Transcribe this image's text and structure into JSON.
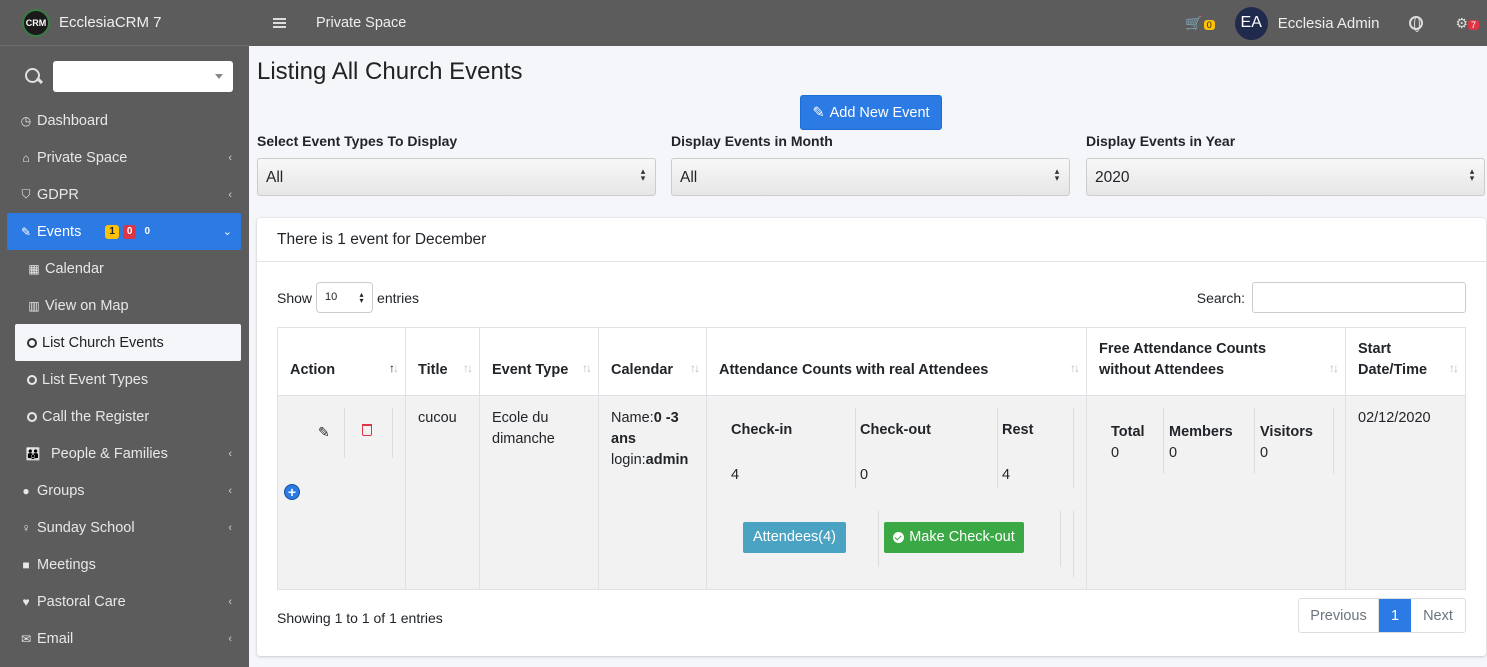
{
  "app": {
    "logo_text": "CRM",
    "name": "EcclesiaCRM 7"
  },
  "topbar": {
    "title": "Private Space",
    "cart_count": "0",
    "avatar_initials": "EA",
    "user_name": "Ecclesia Admin",
    "settings_badge": "7"
  },
  "sidebar": {
    "search_value": "",
    "items": [
      {
        "label": "Dashboard",
        "icon": "dashboard-icon"
      },
      {
        "label": "Private Space",
        "icon": "home-icon"
      },
      {
        "label": "GDPR",
        "icon": "shield-icon"
      },
      {
        "label": "Events",
        "icon": "ticket-icon",
        "badges": [
          "1",
          "0",
          "0"
        ]
      },
      {
        "label": "Calendar",
        "icon": "calendar-icon"
      },
      {
        "label": "View on Map",
        "icon": "map-icon"
      },
      {
        "label": "List Church Events",
        "icon": "circle-icon"
      },
      {
        "label": "List Event Types",
        "icon": "circle-icon"
      },
      {
        "label": "Call the Register",
        "icon": "circle-icon"
      },
      {
        "label": "People & Families",
        "icon": "people-icon"
      },
      {
        "label": "Groups",
        "icon": "users-icon"
      },
      {
        "label": "Sunday School",
        "icon": "child-icon"
      },
      {
        "label": "Meetings",
        "icon": "video-icon"
      },
      {
        "label": "Pastoral Care",
        "icon": "heartbeat-icon"
      },
      {
        "label": "Email",
        "icon": "envelope-icon"
      }
    ]
  },
  "page": {
    "title": "Listing All Church Events",
    "add_button": "Add New Event",
    "filters": [
      {
        "label": "Select Event Types To Display",
        "value": "All"
      },
      {
        "label": "Display Events in Month",
        "value": "All"
      },
      {
        "label": "Display Events in Year",
        "value": "2020"
      }
    ],
    "card_header": "There is 1 event for December",
    "show_label": "Show",
    "entries_value": "10",
    "entries_label": "entries",
    "search_label": "Search:",
    "search_value": "",
    "columns": [
      "Action",
      "Title",
      "Event Type",
      "Calendar",
      "Attendance Counts with real Attendees",
      "Free Attendance Counts without Attendees",
      "Start Date/Time"
    ],
    "row": {
      "title": "cucou",
      "event_type": "Ecole du dimanche",
      "calendar_name_label": "Name:",
      "calendar_name_value": "0 -3 ans",
      "calendar_login_label": "login:",
      "calendar_login_value": "admin",
      "attendance": {
        "headers": [
          "Check-in",
          "Check-out",
          "Rest"
        ],
        "values": [
          "4",
          "0",
          "4"
        ],
        "attendees_button": "Attendees(4)",
        "checkout_button": "Make Check-out"
      },
      "free_attendance": {
        "headers": [
          "Total",
          "Members",
          "Visitors"
        ],
        "values": [
          "0",
          "0",
          "0"
        ]
      },
      "start_date": "02/12/2020"
    },
    "footer_info": "Showing 1 to 1 of 1 entries",
    "pagination": {
      "previous": "Previous",
      "current": "1",
      "next": "Next"
    }
  },
  "colors": {
    "accent": "#2c7be5",
    "sidebar_bg": "#5c5c5c",
    "success": "#3aa845",
    "info": "#4ba3c3",
    "danger": "#dc3545",
    "warning": "#ffc107"
  }
}
